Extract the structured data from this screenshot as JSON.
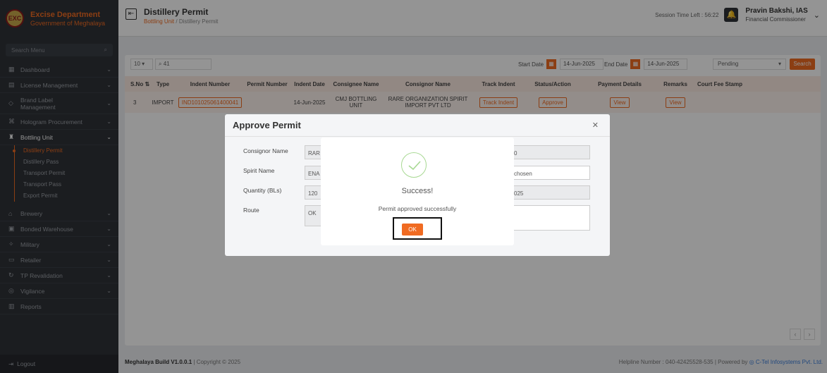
{
  "brand": {
    "title": "Excise Department",
    "subtitle": "Government of Meghalaya",
    "logo_text": "EXC"
  },
  "header": {
    "page_title": "Distillery Permit",
    "breadcrumb_1": "Bottling Unit",
    "breadcrumb_sep": "/",
    "breadcrumb_2": "Distillery Permit",
    "session_label": "Session Time Left : 56:22",
    "user_name": "Pravin Bakshi, IAS",
    "user_role": "Financial Commissioner"
  },
  "sidebar": {
    "search_placeholder": "Search Menu",
    "items": [
      {
        "label": "Dashboard",
        "icon": "grid-icon"
      },
      {
        "label": "License Management",
        "icon": "license-icon"
      },
      {
        "label": "Brand Label Management",
        "icon": "label-icon"
      },
      {
        "label": "Hologram Procurement",
        "icon": "hologram-icon"
      },
      {
        "label": "Bottling Unit",
        "icon": "bottle-icon"
      },
      {
        "label": "Brewery",
        "icon": "brewery-icon"
      },
      {
        "label": "Bonded Warehouse",
        "icon": "warehouse-icon"
      },
      {
        "label": "Military",
        "icon": "military-icon"
      },
      {
        "label": "Retailer",
        "icon": "retailer-icon"
      },
      {
        "label": "TP Revalidation",
        "icon": "revalidation-icon"
      },
      {
        "label": "Vigilance",
        "icon": "vigilance-icon"
      },
      {
        "label": "Reports",
        "icon": "reports-icon"
      }
    ],
    "sub_items": [
      "Distillery Permit",
      "Distillery Pass",
      "Transport Permit",
      "Transport Pass",
      "Export Permit"
    ],
    "logout": "Logout"
  },
  "filters": {
    "per_page": "10",
    "search_value": "41",
    "start_date_label": "Start Date",
    "start_date": "14-Jun-2025",
    "end_date_label": "End Date",
    "end_date": "14-Jun-2025",
    "status": "Pending",
    "search_button": "Search"
  },
  "table": {
    "headers": [
      "S.No",
      "Type",
      "Indent Number",
      "Permit Number",
      "Indent Date",
      "Consignee Name",
      "Consignor Name",
      "Track Indent",
      "Status/Action",
      "Payment Details",
      "Remarks",
      "Court Fee Stamp"
    ],
    "row": {
      "sno": "3",
      "type": "IMPORT",
      "indent_number": "IND101025061400041",
      "permit_number": "",
      "indent_date": "14-Jun-2025",
      "consignee_1": "CMJ BOTTLING",
      "consignee_2": "UNIT",
      "consignor_1": "RARE ORGANIZATION SPIRIT",
      "consignor_2": "IMPORT PVT LTD",
      "track_indent": "Track Indent",
      "status_action": "Approve",
      "payment_details": "View",
      "remarks": "View"
    }
  },
  "modal": {
    "title": "Approve Permit",
    "consignor_label": "Consignor Name",
    "consignor_value": "RAR",
    "spirit_label": "Spirit Name",
    "spirit_value": "ENA",
    "quantity_label": "Quantity (BLs)",
    "quantity_value": "120",
    "route_label": "Route",
    "route_value": "OK",
    "right_1": "0",
    "right_2": "chosen",
    "right_3": "025"
  },
  "alert": {
    "title": "Success!",
    "message": "Permit approved successfully",
    "ok_button": "OK"
  },
  "footer": {
    "build": "Meghalaya Build V1.0.0.1",
    "copyright": "| Copyright © 2025",
    "helpline": "Helpline Number : 040-42425528-535",
    "powered": "| Powered by",
    "company": "C-Tel Infosystems Pvt. Ltd."
  },
  "colors": {
    "accent": "#f06b22",
    "sidebar": "#2f3238",
    "success": "#a8d993"
  }
}
